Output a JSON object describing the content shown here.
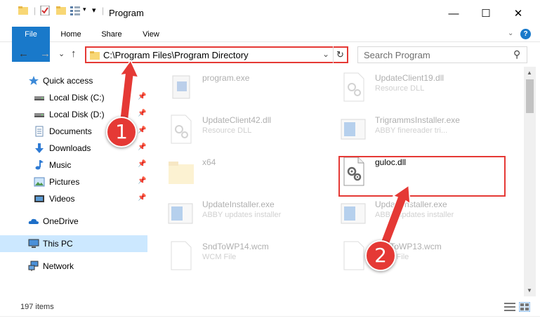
{
  "window": {
    "title": "Program",
    "minimize_glyph": "—",
    "maximize_glyph": "☐",
    "close_glyph": "✕",
    "qa_dropdown_glyph": "▾"
  },
  "ribbon": {
    "tabs": [
      "File",
      "Home",
      "Share",
      "View"
    ],
    "expand_glyph": "⌄",
    "help_glyph": "?"
  },
  "navigation": {
    "back_glyph": "←",
    "forward_glyph": "→",
    "recent_glyph": "⌄",
    "up_glyph": "↑"
  },
  "address_bar": {
    "path": "C:\\Program Files\\Program Directory",
    "dropdown_glyph": "⌄",
    "refresh_glyph": "↻"
  },
  "search": {
    "placeholder": "Search Program",
    "icon_glyph": "⚲"
  },
  "sidebar": {
    "pin_glyph": "📌",
    "items": [
      {
        "label": "Quick access",
        "icon": "star-icon",
        "pinned": false
      },
      {
        "label": "Local Disk (C:)",
        "icon": "drive-icon",
        "pinned": true
      },
      {
        "label": "Local Disk (D:)",
        "icon": "drive-icon",
        "pinned": true
      },
      {
        "label": "Documents",
        "icon": "documents-icon",
        "pinned": true
      },
      {
        "label": "Downloads",
        "icon": "download-icon",
        "pinned": true
      },
      {
        "label": "Music",
        "icon": "music-icon",
        "pinned": true
      },
      {
        "label": "Pictures",
        "icon": "pictures-icon",
        "pinned": true
      },
      {
        "label": "Videos",
        "icon": "videos-icon",
        "pinned": true
      },
      {
        "label": "OneDrive",
        "icon": "cloud-icon",
        "pinned": false
      },
      {
        "label": "This PC",
        "icon": "computer-icon",
        "pinned": false,
        "selected": true
      },
      {
        "label": "Network",
        "icon": "network-icon",
        "pinned": false
      }
    ]
  },
  "files": [
    {
      "name": "program.exe",
      "desc": "",
      "icon": "exe-icon",
      "faded": true
    },
    {
      "name": "UpdateClient19.dll",
      "desc": "Resource DLL",
      "icon": "dll-icon",
      "faded": true
    },
    {
      "name": "UpdateClient42.dll",
      "desc": "Resource DLL",
      "icon": "dll-icon",
      "faded": true
    },
    {
      "name": "TrigrammsInstaller.exe",
      "desc": "ABBY finereader tri...",
      "icon": "installer-icon",
      "faded": true
    },
    {
      "name": "x64",
      "desc": "",
      "icon": "folder-icon",
      "faded": true
    },
    {
      "name": "guloc.dll",
      "desc": "",
      "icon": "dll-icon",
      "faded": false,
      "highlighted": true
    },
    {
      "name": "UpdateInstaller.exe",
      "desc": "ABBY updates installer",
      "icon": "installer-icon",
      "faded": true
    },
    {
      "name": "UpdateInstaller.exe",
      "desc": "ABBY updates installer",
      "icon": "installer-icon",
      "faded": true
    },
    {
      "name": "SndToWP14.wcm",
      "desc": "WCM File",
      "icon": "file-icon",
      "faded": true
    },
    {
      "name": "SndToWP13.wcm",
      "desc": "WCM File",
      "icon": "file-icon",
      "faded": true
    }
  ],
  "status": {
    "item_count": "197 items"
  },
  "annotations": {
    "step1": "1",
    "step2": "2",
    "color": "#e53935"
  }
}
